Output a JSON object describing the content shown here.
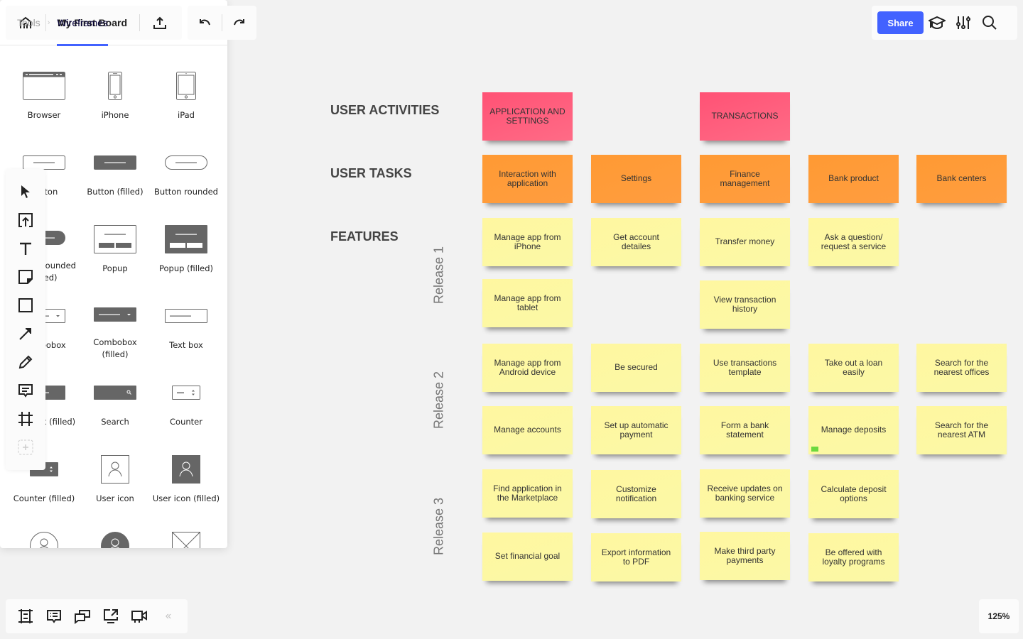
{
  "header": {
    "board_title": "My First Board",
    "share_label": "Share"
  },
  "library": {
    "breadcrumb_root": "Tools",
    "breadcrumb_active": "Wireframes",
    "items": [
      {
        "label": "Browser",
        "icon": "browser-icon"
      },
      {
        "label": "iPhone",
        "icon": "iphone-icon"
      },
      {
        "label": "iPad",
        "icon": "ipad-icon"
      },
      {
        "label": "Button",
        "icon": "button-icon"
      },
      {
        "label": "Button (filled)",
        "icon": "button-filled-icon"
      },
      {
        "label": "Button rounded",
        "icon": "button-rounded-icon"
      },
      {
        "label": "Button rounded (filled)",
        "icon": "button-rounded-filled-icon"
      },
      {
        "label": "Popup",
        "icon": "popup-icon"
      },
      {
        "label": "Popup (filled)",
        "icon": "popup-filled-icon"
      },
      {
        "label": "Combobox",
        "icon": "combobox-icon"
      },
      {
        "label": "Combobox (filled)",
        "icon": "combobox-filled-icon"
      },
      {
        "label": "Text box",
        "icon": "text-box-icon"
      },
      {
        "label": "Text box (filled)",
        "icon": "text-box-filled-icon"
      },
      {
        "label": "Search",
        "icon": "search-field-icon"
      },
      {
        "label": "Counter",
        "icon": "counter-icon"
      },
      {
        "label": "Counter (filled)",
        "icon": "counter-filled-icon"
      },
      {
        "label": "User icon",
        "icon": "user-icon"
      },
      {
        "label": "User icon (filled)",
        "icon": "user-filled-icon"
      },
      {
        "label": "",
        "icon": "user-round-icon"
      },
      {
        "label": "",
        "icon": "user-round-filled-icon"
      },
      {
        "label": "",
        "icon": "image-placeholder-icon"
      }
    ]
  },
  "zoom_level": "125%",
  "board": {
    "row_labels": {
      "activities": "USER ACTIVITIES",
      "tasks": "USER TASKS",
      "features": "FEATURES"
    },
    "releases": [
      "Release 1",
      "Release 2",
      "Release 3"
    ],
    "colors": {
      "activity": "#ff5a7b",
      "task": "#ff9b38",
      "feature": "#fdf8a3",
      "tag": "#6cd83f"
    },
    "activities": [
      "APPLICATION AND SETTINGS",
      "TRANSACTIONS"
    ],
    "tasks": [
      "Interaction with application",
      "Settings",
      "Finance management",
      "Bank product",
      "Bank centers"
    ],
    "features": [
      "Manage app from iPhone",
      "Get account detailes",
      "Transfer money",
      "Ask a question/ request a service",
      "Manage app from tablet",
      "View transaction history",
      "Manage app from Android device",
      "Be secured",
      "Use transactions template",
      "Take out a loan easily",
      "Search for the nearest offices",
      "Manage accounts",
      "Set up automatic payment",
      "Form a bank statement",
      "Manage deposits",
      "Search for the nearest ATM",
      "Find application in the Marketplace",
      "Customize notification",
      "Receive updates on banking service",
      "Calculate deposit options",
      "Set financial goal",
      "Export information to PDF",
      "Make third party payments",
      "Be offered with loyalty programs"
    ]
  }
}
